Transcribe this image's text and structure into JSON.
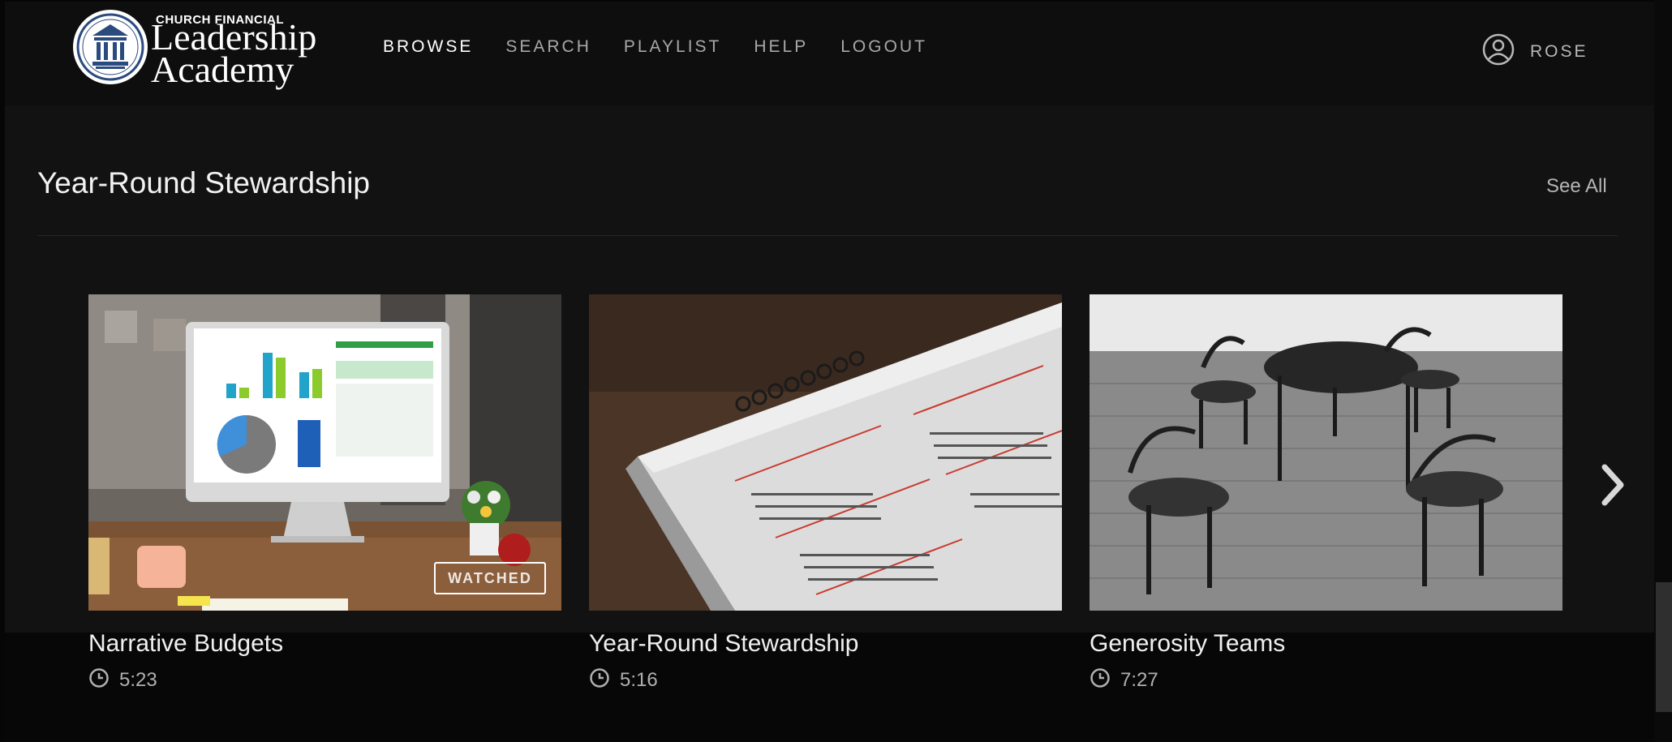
{
  "brand": {
    "line1": "CHURCH FINANCIAL",
    "line2": "Leadership",
    "line3": "Academy",
    "accent": "#2b4a7e"
  },
  "nav": {
    "items": [
      {
        "label": "BROWSE",
        "active": true
      },
      {
        "label": "SEARCH",
        "active": false
      },
      {
        "label": "PLAYLIST",
        "active": false
      },
      {
        "label": "HELP",
        "active": false
      },
      {
        "label": "LOGOUT",
        "active": false
      }
    ]
  },
  "user": {
    "name": "ROSE",
    "icon": "user-circle-icon"
  },
  "section": {
    "title": "Year-Round Stewardship",
    "see_all": "See All"
  },
  "cards": [
    {
      "title": "Narrative Budgets",
      "duration": "5:23",
      "badge": "WATCHED",
      "image": "desk-monitor-financial-report"
    },
    {
      "title": "Year-Round Stewardship",
      "duration": "5:16",
      "image": "calendar-closeup"
    },
    {
      "title": "Generosity Teams",
      "duration": "7:27",
      "image": "black-table-and-chairs"
    }
  ],
  "icons": {
    "clock": "clock-icon",
    "next": "chevron-right-icon"
  }
}
